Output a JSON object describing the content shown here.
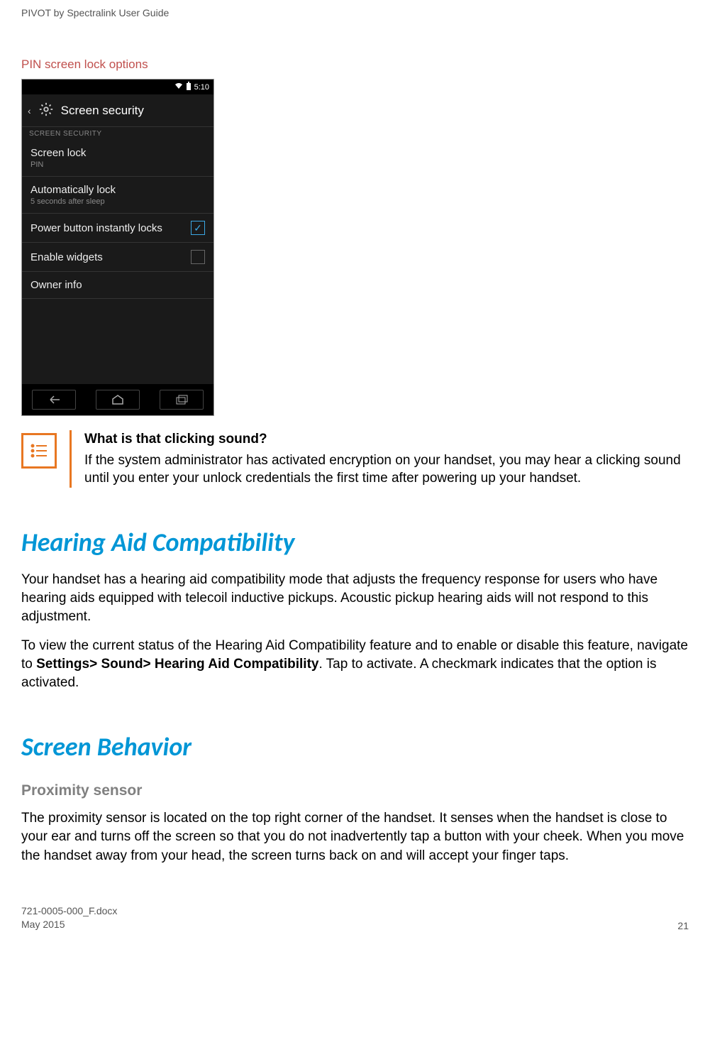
{
  "header": {
    "title": "PIVOT by Spectralink User Guide"
  },
  "caption": "PIN screen lock options",
  "phone": {
    "time": "5:10",
    "screenTitle": "Screen security",
    "sectionLabel": "SCREEN SECURITY",
    "rows": {
      "lock": {
        "title": "Screen lock",
        "sub": "PIN"
      },
      "auto": {
        "title": "Automatically lock",
        "sub": "5 seconds after sleep"
      },
      "power": {
        "title": "Power button instantly locks"
      },
      "widgets": {
        "title": "Enable widgets"
      },
      "owner": {
        "title": "Owner info"
      }
    }
  },
  "note": {
    "heading": "What is that clicking sound?",
    "body": "If the system administrator has activated encryption on your handset, you may hear a clicking sound until you enter your unlock credentials the first time after powering up your handset."
  },
  "section1": {
    "title": "Hearing Aid Compatibility",
    "p1": "Your handset has a hearing aid compatibility mode that adjusts the frequency response for users who have hearing aids equipped with telecoil inductive pickups. Acoustic pickup hearing aids will not respond to this adjustment.",
    "p2_a": "To view the current status of the Hearing Aid Compatibility feature and to enable or disable this feature, navigate to ",
    "p2_bold": "Settings> Sound> Hearing Aid Compatibility",
    "p2_b": ". Tap to activate. A checkmark indicates that the option is activated."
  },
  "section2": {
    "title": "Screen Behavior",
    "sub1": "Proximity sensor",
    "p1": "The proximity sensor is located on the top right corner of the handset. It senses when the handset is close to your ear and turns off the screen so that you do not inadvertently tap a button with your cheek. When you move the handset away from your head, the screen turns back on and will accept your finger taps."
  },
  "footer": {
    "doc": "721-0005-000_F.docx",
    "date": "May 2015",
    "page": "21"
  }
}
